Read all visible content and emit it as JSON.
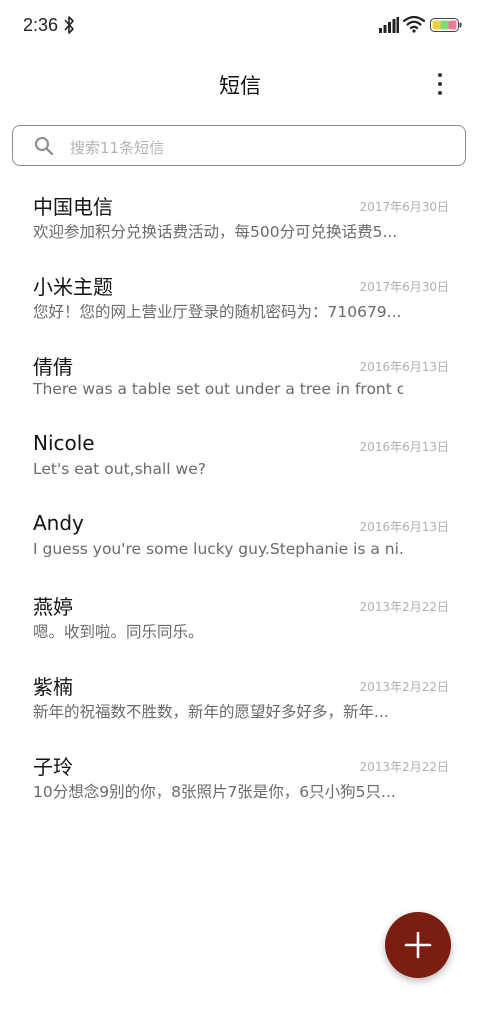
{
  "status_bar": {
    "time": "2:36",
    "icons": [
      "bluetooth-icon",
      "signal-icon",
      "wifi-icon",
      "battery-icon"
    ]
  },
  "app_bar": {
    "title": "短信",
    "more_icon": "more-vertical-icon"
  },
  "search": {
    "placeholder": "搜索11条短信",
    "icon": "search-icon"
  },
  "messages": [
    {
      "sender": "中国电信",
      "date": "2017年6月30日",
      "preview": "欢迎参加积分兑换话费活动，每500分可兑换话费5..."
    },
    {
      "sender": "小米主题",
      "date": "2017年6月30日",
      "preview": "您好！您的网上营业厅登录的随机密码为：710679..."
    },
    {
      "sender": "倩倩",
      "date": "2016年6月13日",
      "preview": "There was a table set out under a tree in front of ..."
    },
    {
      "sender": "Nicole",
      "date": "2016年6月13日",
      "preview": "Let's eat out,shall we?"
    },
    {
      "sender": "Andy",
      "date": "2016年6月13日",
      "preview": "I guess you're some lucky guy.Stephanie is a ni..."
    },
    {
      "sender": "燕婷",
      "date": "2013年2月22日",
      "preview": "嗯。收到啦。同乐同乐。"
    },
    {
      "sender": "紫楠",
      "date": "2013年2月22日",
      "preview": "新年的祝福数不胜数，新年的愿望好多好多，新年..."
    },
    {
      "sender": "子玲",
      "date": "2013年2月22日",
      "preview": "10分想念9别的你，8张照片7张是你，6只小狗5只..."
    }
  ],
  "fab": {
    "icon": "plus-icon"
  },
  "colors": {
    "fab_background": "#7b1e12",
    "date_text": "#b0b0b0",
    "preview_text": "#6a6a6a"
  }
}
